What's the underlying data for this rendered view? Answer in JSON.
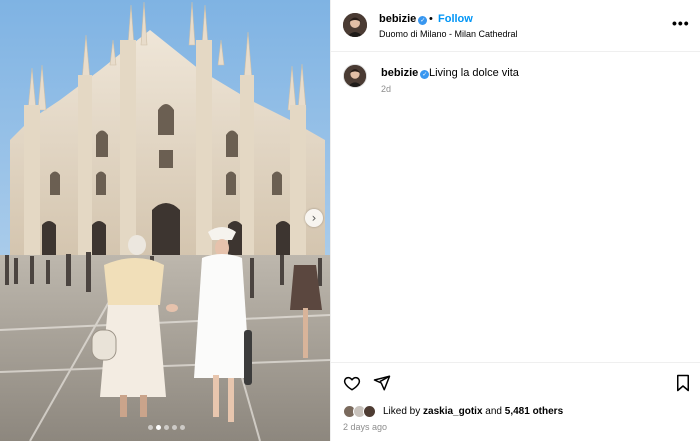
{
  "post": {
    "username": "bebizie",
    "header_separator": "•",
    "follow_label": "Follow",
    "location": "Duomo di Milano - Milan Cathedral",
    "more_label": "•••",
    "verified_mark": "✓",
    "caption": {
      "username": "bebizie",
      "text": "Living la dolce vita",
      "time": "2d"
    },
    "next_label": "›",
    "carousel": {
      "count": 5,
      "active_index": 1
    },
    "likes": {
      "prefix": "Liked by ",
      "user": "zaskia_gotix",
      "middle": " and ",
      "others": "5,481 others"
    },
    "posted_ago": "2 days ago",
    "icons": {
      "like": "heart-icon",
      "share": "send-icon",
      "save": "bookmark-icon",
      "more": "more-horizontal-icon",
      "next": "chevron-right-icon"
    },
    "colors": {
      "accent": "#0095f6",
      "verified": "#3897f0",
      "muted": "#8e8e8e",
      "divider": "#efefef"
    }
  }
}
